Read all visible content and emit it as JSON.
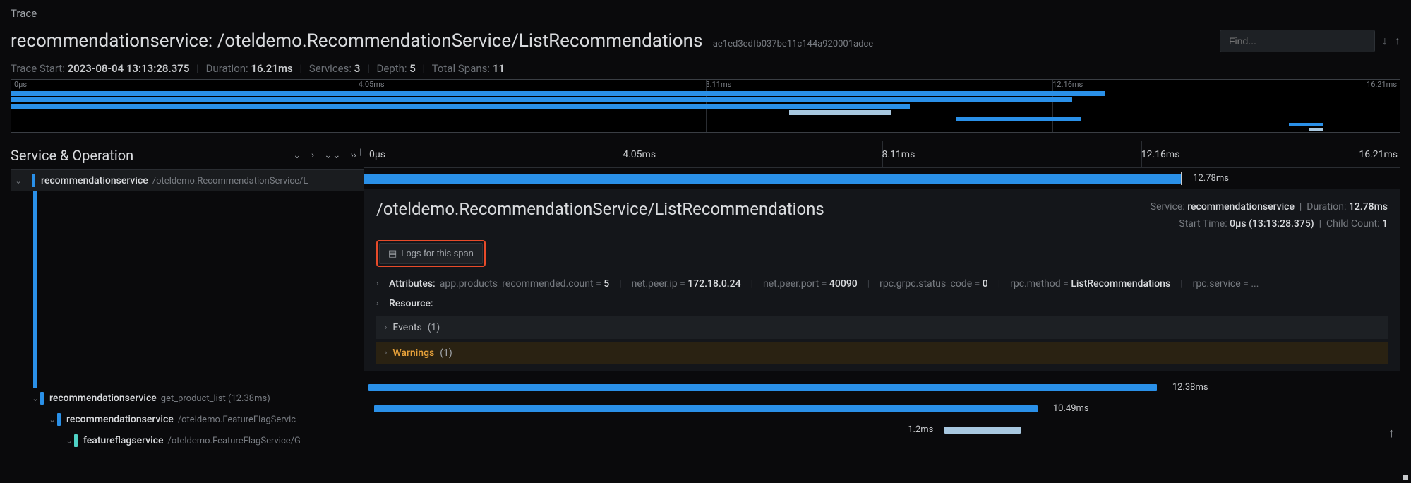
{
  "page_label": "Trace",
  "header": {
    "service": "recommendationservice",
    "operation": "/oteldemo.RecommendationService/ListRecommendations",
    "trace_id": "ae1ed3edfb037be11c144a920001adce",
    "find_placeholder": "Find..."
  },
  "meta": {
    "start_label": "Trace Start:",
    "start_value": "2023-08-04 13:13:28.375",
    "duration_label": "Duration:",
    "duration_value": "16.21ms",
    "services_label": "Services:",
    "services_value": "3",
    "depth_label": "Depth:",
    "depth_value": "5",
    "spans_label": "Total Spans:",
    "spans_value": "11"
  },
  "minimap_ticks": [
    "0µs",
    "4.05ms",
    "8.11ms",
    "12.16ms",
    "16.21ms"
  ],
  "left": {
    "title": "Service & Operation",
    "rows": [
      {
        "svc": "recommendationservice",
        "op": "/oteldemo.RecommendationService/L",
        "indent": 0
      },
      {
        "svc": "recommendationservice",
        "op": "get_product_list (12.38ms)",
        "indent": 1
      },
      {
        "svc": "recommendationservice",
        "op": "/oteldemo.FeatureFlagServic",
        "indent": 2
      },
      {
        "svc": "featureflagservice",
        "op": "/oteldemo.FeatureFlagService/G",
        "indent": 3,
        "teal": true
      }
    ]
  },
  "timeline_ticks": [
    "0µs",
    "4.05ms",
    "8.11ms",
    "12.16ms",
    "16.21ms"
  ],
  "span_durations": {
    "main": "12.78ms",
    "r2": "12.38ms",
    "r3": "10.49ms",
    "r4": "1.2ms"
  },
  "detail": {
    "title": "/oteldemo.RecommendationService/ListRecommendations",
    "service_label": "Service:",
    "service_value": "recommendationservice",
    "duration_label": "Duration:",
    "duration_value": "12.78ms",
    "start_label": "Start Time:",
    "start_value": "0µs (13:13:28.375)",
    "child_label": "Child Count:",
    "child_value": "1",
    "logs_btn": "Logs for this span",
    "attributes_label": "Attributes:",
    "attrs": [
      {
        "k": "app.products_recommended.count",
        "v": "5"
      },
      {
        "k": "net.peer.ip",
        "v": "172.18.0.24"
      },
      {
        "k": "net.peer.port",
        "v": "40090"
      },
      {
        "k": "rpc.grpc.status_code",
        "v": "0"
      },
      {
        "k": "rpc.method",
        "v": "ListRecommendations"
      },
      {
        "k": "rpc.service",
        "v": "..."
      }
    ],
    "resource_label": "Resource:",
    "events_label": "Events",
    "events_count": "(1)",
    "warnings_label": "Warnings",
    "warnings_count": "(1)"
  }
}
